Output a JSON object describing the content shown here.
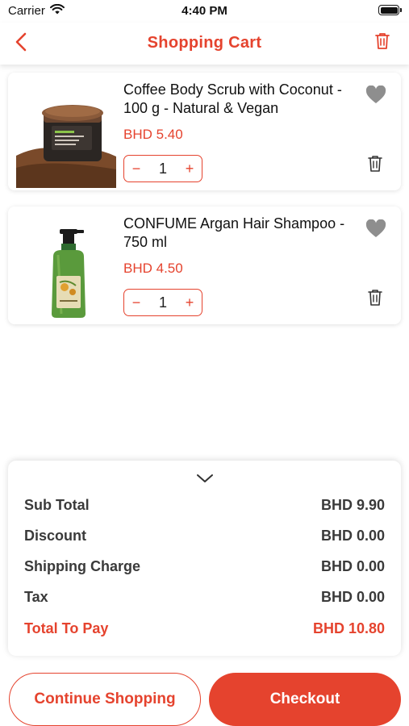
{
  "status_bar": {
    "carrier": "Carrier",
    "time": "4:40 PM"
  },
  "header": {
    "title": "Shopping Cart",
    "back_icon": "chevron-left-icon",
    "clear_icon": "trash-icon"
  },
  "colors": {
    "accent": "#e5432e",
    "favorite_gray": "#8e8e8e"
  },
  "cart_items": [
    {
      "name": "Coffee Body Scrub with Coconut - 100 g - Natural & Vegan",
      "price": "BHD 5.40",
      "quantity": "1",
      "decrement": "−",
      "increment": "+"
    },
    {
      "name": "CONFUME Argan Hair Shampoo - 750 ml",
      "price": "BHD 4.50",
      "quantity": "1",
      "decrement": "−",
      "increment": "+"
    }
  ],
  "summary": {
    "toggle_icon": "chevron-down-icon",
    "rows": [
      {
        "label": "Sub Total",
        "value": "BHD 9.90"
      },
      {
        "label": "Discount",
        "value": "BHD 0.00"
      },
      {
        "label": "Shipping Charge",
        "value": "BHD 0.00"
      },
      {
        "label": "Tax",
        "value": "BHD 0.00"
      }
    ],
    "total": {
      "label": "Total To Pay",
      "value": "BHD 10.80"
    }
  },
  "actions": {
    "continue_label": "Continue Shopping",
    "checkout_label": "Checkout"
  }
}
